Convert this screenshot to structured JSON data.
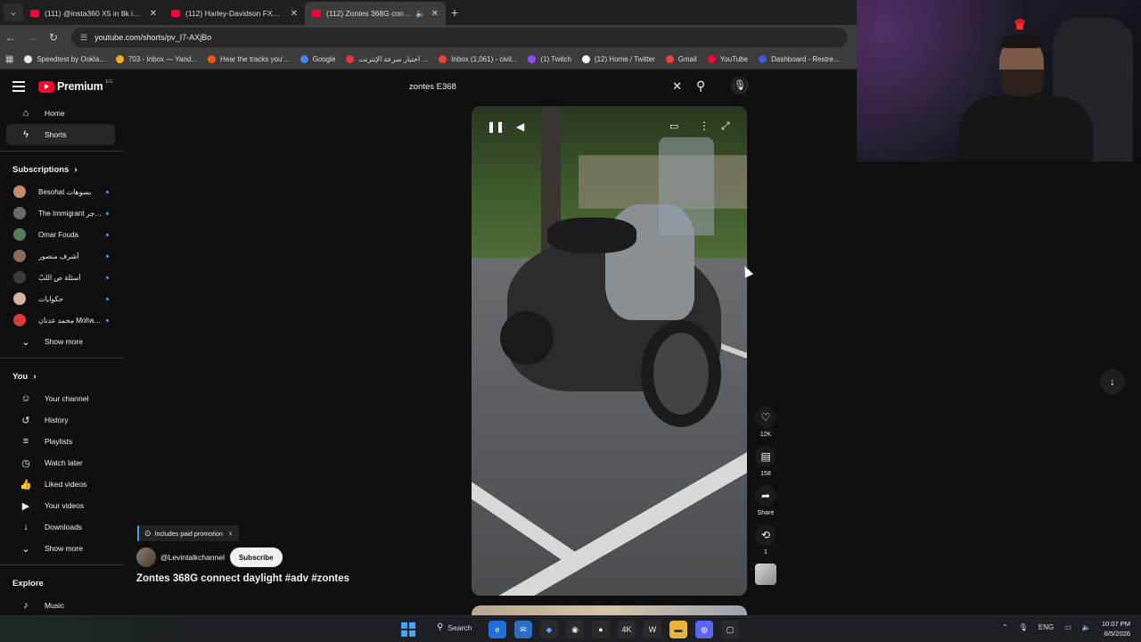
{
  "browser": {
    "tabs": [
      {
        "title": "(111) @insta360 X5 in 8k is just",
        "active": false
      },
      {
        "title": "(112) Harley-Davidson FXS8 Bla",
        "active": false
      },
      {
        "title": "(112) Zontes 368G connect",
        "active": true
      }
    ],
    "url": "youtube.com/shorts/pv_I7-AXjBo",
    "bookmarks": [
      {
        "label": "Speedtest by Ookla...",
        "color": "#e8e8e8"
      },
      {
        "label": "703 - Inbox — Yand...",
        "color": "#f5a623"
      },
      {
        "label": "Hear the tracks you'...",
        "color": "#ff5500"
      },
      {
        "label": "Google",
        "color": "#4285f4"
      },
      {
        "label": "اختبار سرعة الإنترنت ...",
        "color": "#e53935"
      },
      {
        "label": "Inbox (1,061) - civil...",
        "color": "#ea4335"
      },
      {
        "label": "(1) Twitch",
        "color": "#9146ff"
      },
      {
        "label": "(12) Home / Twitter",
        "color": "#ffffff"
      },
      {
        "label": "Gmail",
        "color": "#ea4335"
      },
      {
        "label": "YouTube",
        "color": "#ff0033"
      },
      {
        "label": "Dashboard - Restre...",
        "color": "#3b5bdb"
      }
    ]
  },
  "youtube": {
    "logo": "Premium",
    "country": "EG",
    "search_query": "zontes E368",
    "nav": [
      {
        "label": "Home",
        "icon": "home-icon",
        "glyph": "⌂",
        "active": false
      },
      {
        "label": "Shorts",
        "icon": "shorts-icon",
        "glyph": "ϟ",
        "active": true
      }
    ],
    "subscriptions_title": "Subscriptions",
    "subscriptions": [
      {
        "label": "Besohat بسوهات",
        "color": "#c98a6a"
      },
      {
        "label": "The Immigrant المهاجر",
        "color": "#6a6a6a"
      },
      {
        "label": "Omar Fouda",
        "color": "#5a7a5a"
      },
      {
        "label": "أشرف منصور",
        "color": "#8a6a5a"
      },
      {
        "label": "أسئلة ص اللبّ",
        "color": "#3a3a3a"
      },
      {
        "label": "حكوايات",
        "color": "#d9b3a0"
      },
      {
        "label": "محمد عدنان Mohamad...",
        "color": "#d93a3a"
      }
    ],
    "show_more": "Show more",
    "you_title": "You",
    "you_items": [
      {
        "label": "Your channel",
        "icon": "your-channel-icon",
        "glyph": "☺"
      },
      {
        "label": "History",
        "icon": "history-icon",
        "glyph": "↺"
      },
      {
        "label": "Playlists",
        "icon": "playlists-icon",
        "glyph": "≡"
      },
      {
        "label": "Watch later",
        "icon": "watch-later-icon",
        "glyph": "◷"
      },
      {
        "label": "Liked videos",
        "icon": "liked-videos-icon",
        "glyph": "👍"
      },
      {
        "label": "Your videos",
        "icon": "your-videos-icon",
        "glyph": "▶"
      },
      {
        "label": "Downloads",
        "icon": "downloads-icon",
        "glyph": "↓"
      }
    ],
    "show_more_2": "Show more",
    "explore_title": "Explore",
    "explore_items": [
      {
        "label": "Music",
        "icon": "music-icon",
        "glyph": "♪"
      }
    ],
    "short": {
      "paid_promotion": "Includes paid promotion",
      "channel": "@Levintalkchannel",
      "subscribe": "Subscribe",
      "title": "Zontes 368G connect daylight #adv #zontes",
      "likes": "12K",
      "comments": "158",
      "share": "Share",
      "remix": "1"
    }
  },
  "taskbar": {
    "search": "Search",
    "language": "ENG",
    "time": "10:07 PM",
    "date": "8/5/2026"
  }
}
